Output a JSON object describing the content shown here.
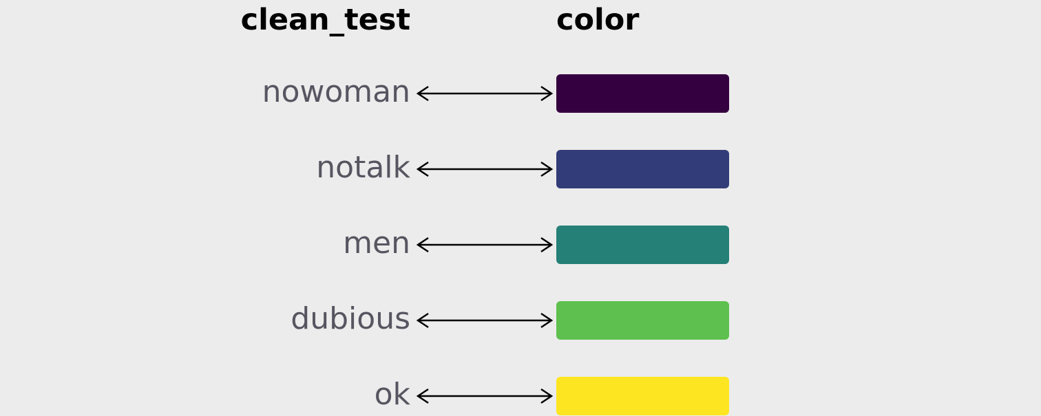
{
  "headers": {
    "left": "clean_test",
    "right": "color"
  },
  "mappings": [
    {
      "label": "nowoman",
      "color": "#35003f"
    },
    {
      "label": "notalk",
      "color": "#323c78"
    },
    {
      "label": "men",
      "color": "#258077"
    },
    {
      "label": "dubious",
      "color": "#5ec04e"
    },
    {
      "label": "ok",
      "color": "#fde521"
    }
  ]
}
